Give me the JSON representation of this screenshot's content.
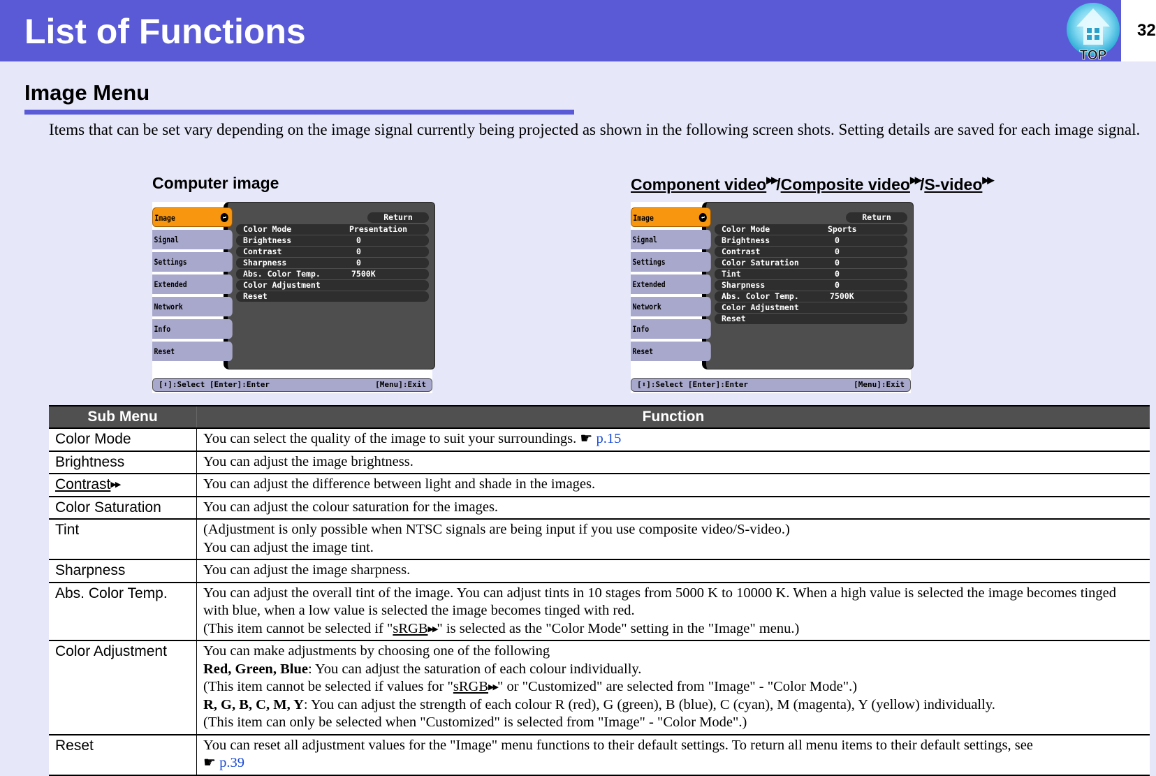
{
  "header": {
    "title": "List of Functions",
    "page_number": "32",
    "top_button_label": "TOP"
  },
  "section": {
    "title": "Image Menu",
    "intro": "Items that can be set vary depending on the image signal currently being projected as shown in the following screen shots. Setting details are saved for each image signal."
  },
  "screens": {
    "computer": {
      "heading": "Computer image",
      "tabs": [
        "Image",
        "Signal",
        "Settings",
        "Extended",
        "Network",
        "Info",
        "Reset"
      ],
      "return_label": "Return",
      "items": [
        {
          "label": "Color Mode",
          "value": "Presentation"
        },
        {
          "label": "Brightness",
          "value": "0"
        },
        {
          "label": "Contrast",
          "value": "0"
        },
        {
          "label": "Sharpness",
          "value": "0"
        },
        {
          "label": "Abs. Color Temp.",
          "value": "7500K"
        },
        {
          "label": "Color Adjustment",
          "value": ""
        },
        {
          "label": "Reset",
          "value": ""
        }
      ],
      "footer_left": "[⬍]:Select [Enter]:Enter",
      "footer_right": "[Menu]:Exit"
    },
    "video": {
      "heading_links": [
        "Component video",
        "Composite video",
        "S-video"
      ],
      "separator": "/",
      "tabs": [
        "Image",
        "Signal",
        "Settings",
        "Extended",
        "Network",
        "Info",
        "Reset"
      ],
      "return_label": "Return",
      "items": [
        {
          "label": "Color Mode",
          "value": "Sports"
        },
        {
          "label": "Brightness",
          "value": "0"
        },
        {
          "label": "Contrast",
          "value": "0"
        },
        {
          "label": "Color Saturation",
          "value": "0"
        },
        {
          "label": "Tint",
          "value": "0"
        },
        {
          "label": "Sharpness",
          "value": "0"
        },
        {
          "label": "Abs. Color Temp.",
          "value": "7500K"
        },
        {
          "label": "Color Adjustment",
          "value": ""
        },
        {
          "label": "Reset",
          "value": ""
        }
      ],
      "footer_left": "[⬍]:Select [Enter]:Enter",
      "footer_right": "[Menu]:Exit"
    }
  },
  "table": {
    "headers": [
      "Sub Menu",
      "Function"
    ],
    "rows": {
      "color_mode": {
        "sub": "Color Mode",
        "text": "You can select the quality of the image to suit your surroundings.",
        "xref": "p.15"
      },
      "brightness": {
        "sub": "Brightness",
        "text": "You can adjust the image brightness."
      },
      "contrast": {
        "sub": "Contrast",
        "text": "You can adjust the difference between light and shade in the images."
      },
      "color_saturation": {
        "sub": "Color Saturation",
        "text": "You can adjust the colour saturation for the images."
      },
      "tint": {
        "sub": "Tint",
        "line1": "(Adjustment is only possible when NTSC signals are being input if you use composite video/S-video.)",
        "line2": "You can adjust the image tint."
      },
      "sharpness": {
        "sub": "Sharpness",
        "text": "You can adjust the image sharpness."
      },
      "abs_color_temp": {
        "sub": "Abs. Color Temp.",
        "line1": "You can adjust the overall tint of the image. You can adjust tints in 10 stages from 5000 K to 10000 K. When a high value is selected the image becomes tinged with blue, when a low value is selected the image becomes tinged with red.",
        "line2_pre": "(This item cannot be selected if \"",
        "line2_link": "sRGB",
        "line2_post": "\" is selected as the \"Color Mode\" setting in the \"Image\" menu.)"
      },
      "color_adjustment": {
        "sub": "Color Adjustment",
        "line1": "You can make adjustments by choosing one of the following",
        "rgb_bold": "Red, Green, Blue",
        "rgb_text": ": You can adjust the saturation of each colour individually.",
        "rgb_note_pre": "(This item cannot be selected if values for \"",
        "rgb_note_link": "sRGB",
        "rgb_note_post": "\" or \"Customized\" are selected from \"Image\" - \"Color Mode\".)",
        "rgbcmy_bold": "R, G, B, C, M, Y",
        "rgbcmy_text": ": You can adjust the strength of each colour R (red), G (green), B (blue), C (cyan), M (magenta), Y (yellow) individually.",
        "rgbcmy_note": "(This item can only be selected when \"Customized\" is selected from \"Image\" - \"Color Mode\".)"
      },
      "reset": {
        "sub": "Reset",
        "text": "You can reset all adjustment values for the \"Image\" menu functions to their default settings. To return all menu items to their default settings, see",
        "xref": "p.39"
      }
    }
  },
  "icons": {
    "xref_hand": "☛",
    "glossary_arrow": "▸▸"
  },
  "colors": {
    "brand": "#5a5ad7",
    "background": "#e6e8fa",
    "table_header": "#505050",
    "xref": "#1a4bd6",
    "active_tab": "#f8960f"
  }
}
